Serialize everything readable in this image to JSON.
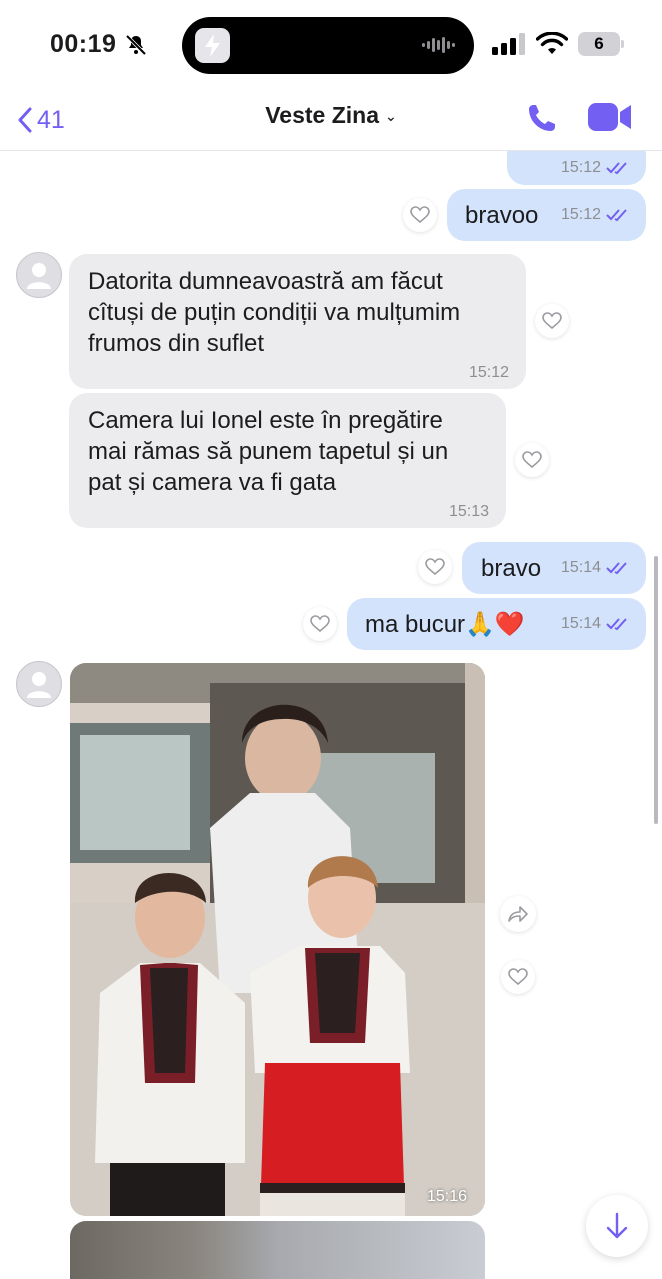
{
  "status_bar": {
    "time": "00:19",
    "battery_level": "6",
    "icons": [
      "bell-slash-icon",
      "bolt-icon",
      "audio-wave-icon",
      "signal-icon",
      "wifi-icon",
      "battery-icon"
    ]
  },
  "header": {
    "back_count": "41",
    "chat_title": "Veste Zina",
    "icons": [
      "chevron-left-icon",
      "chevron-down-icon",
      "phone-icon",
      "video-camera-icon"
    ],
    "accent_color": "#7360f2"
  },
  "messages": [
    {
      "direction": "out",
      "text": "",
      "time": "15:12",
      "partial": true
    },
    {
      "direction": "out",
      "text": "bravoo",
      "time": "15:12"
    },
    {
      "direction": "in",
      "lines": [
        "Datorita dumneavoastră am făcut",
        "cîtuși de puțin condiții va mulțumim",
        "frumos din suflet"
      ],
      "time": "15:12"
    },
    {
      "direction": "in",
      "lines": [
        "Camera lui Ionel este în pregătire",
        "mai rămas să punem tapetul și un",
        "pat și camera va fi gata"
      ],
      "time": "15:13"
    },
    {
      "direction": "out",
      "text": "bravo",
      "time": "15:14"
    },
    {
      "direction": "out",
      "text": "ma bucur🙏❤️",
      "time": "15:14"
    },
    {
      "direction": "in",
      "type": "photo",
      "time": "15:16"
    },
    {
      "direction": "in",
      "type": "photo",
      "time": "",
      "partial": true
    }
  ],
  "colors": {
    "outgoing_bubble": "#d3e3fb",
    "incoming_bubble": "#ececee",
    "read_ticks": "#7360f2"
  }
}
